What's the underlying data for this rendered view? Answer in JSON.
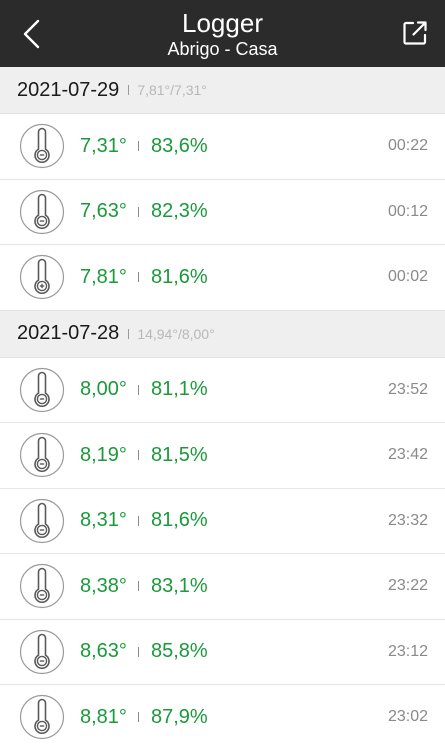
{
  "header": {
    "title": "Logger",
    "subtitle": "Abrigo - Casa",
    "icons": {
      "back": "chevron-left-icon",
      "share": "external-link-icon"
    }
  },
  "colors": {
    "header_bg": "#2b2b2b",
    "value_green": "#1a9a3a",
    "section_bg": "#efefef"
  },
  "sections": [
    {
      "date": "2021-07-29",
      "range": "7,81°/7,31°",
      "rows": [
        {
          "temp": "7,31°",
          "hum": "83,6%",
          "time": "00:22",
          "trend": "minus"
        },
        {
          "temp": "7,63°",
          "hum": "82,3%",
          "time": "00:12",
          "trend": "minus"
        },
        {
          "temp": "7,81°",
          "hum": "81,6%",
          "time": "00:02",
          "trend": "plus"
        }
      ]
    },
    {
      "date": "2021-07-28",
      "range": "14,94°/8,00°",
      "rows": [
        {
          "temp": "8,00°",
          "hum": "81,1%",
          "time": "23:52",
          "trend": "minus"
        },
        {
          "temp": "8,19°",
          "hum": "81,5%",
          "time": "23:42",
          "trend": "minus"
        },
        {
          "temp": "8,31°",
          "hum": "81,6%",
          "time": "23:32",
          "trend": "minus"
        },
        {
          "temp": "8,38°",
          "hum": "83,1%",
          "time": "23:22",
          "trend": "minus"
        },
        {
          "temp": "8,63°",
          "hum": "85,8%",
          "time": "23:12",
          "trend": "minus"
        },
        {
          "temp": "8,81°",
          "hum": "87,9%",
          "time": "23:02",
          "trend": "minus"
        }
      ]
    }
  ]
}
